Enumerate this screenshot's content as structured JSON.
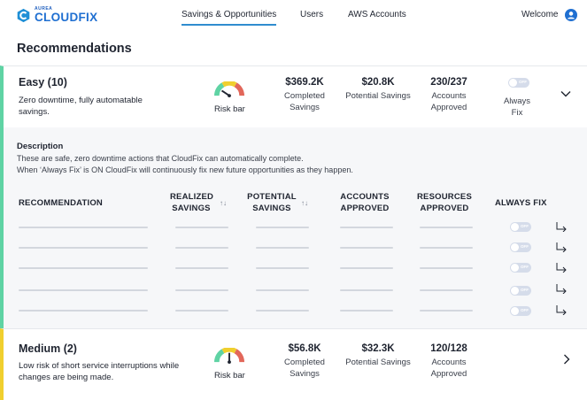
{
  "brand": {
    "small": "AUREA",
    "name": "CLOUDFIX",
    "color": "#1f6fd1"
  },
  "nav": {
    "items": [
      "Savings & Opportunities",
      "Users",
      "AWS Accounts"
    ],
    "active": "Savings & Opportunities",
    "welcome": "Welcome"
  },
  "page": {
    "title": "Recommendations"
  },
  "tiers": {
    "easy": {
      "title": "Easy (10)",
      "description": "Zero downtime, fully automatable savings.",
      "risk_label": "Risk bar",
      "completed_value": "$369.2K",
      "completed_label": "Completed Savings",
      "potential_value": "$20.8K",
      "potential_label": "Potential Savings",
      "accounts_value": "230/237",
      "accounts_label": "Accounts Approved",
      "always_fix_label": "Always Fix",
      "toggle_text": "OFF",
      "accent": "#5fd3a4",
      "expanded": true
    },
    "medium": {
      "title": "Medium (2)",
      "description": "Low risk of short service interruptions while changes are being made.",
      "risk_label": "Risk bar",
      "completed_value": "$56.8K",
      "completed_label": "Completed Savings",
      "potential_value": "$32.3K",
      "potential_label": "Potential Savings",
      "accounts_value": "120/128",
      "accounts_label": "Accounts Approved",
      "accent": "#f0cf2e",
      "expanded": false
    }
  },
  "panel": {
    "description_heading": "Description",
    "description_lines": [
      "These are safe, zero downtime actions that CloudFix can automatically complete.",
      "When ‘Always Fix’ is ON CloudFix will continuously fix new future opportunities as they happen."
    ],
    "columns": {
      "recommendation": "RECOMMENDATION",
      "realized_1": "REALIZED",
      "realized_2": "SAVINGS",
      "potential_1": "POTENTIAL",
      "potential_2": "SAVINGS",
      "accounts_1": "ACCOUNTS",
      "accounts_2": "APPROVED",
      "resources_1": "RESOURCES",
      "resources_2": "APPROVED",
      "always_fix": "ALWAYS FIX"
    },
    "sort_icon": "↑↓",
    "row_toggle_text": "OFF"
  }
}
